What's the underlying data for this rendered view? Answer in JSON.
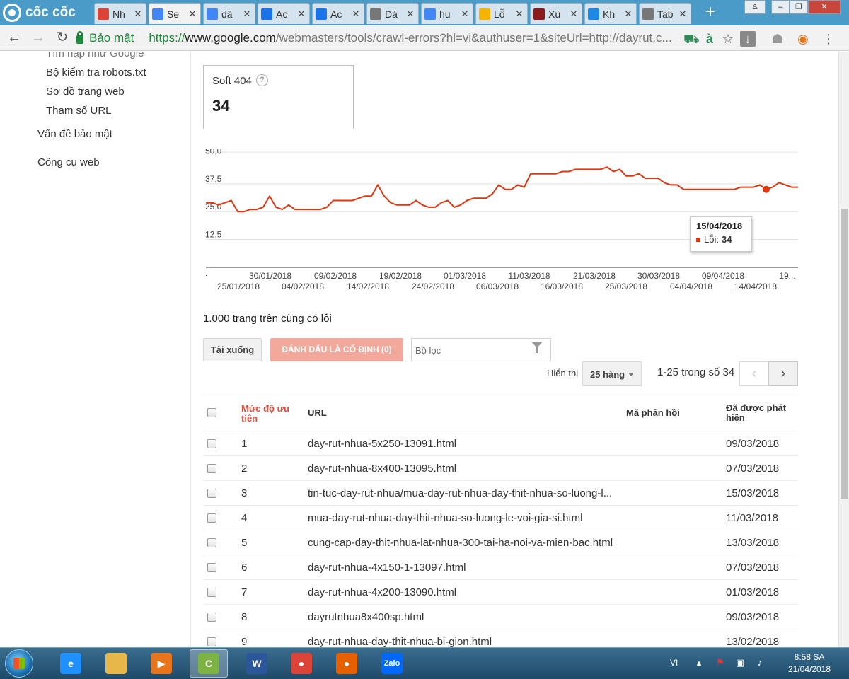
{
  "browser": {
    "brand": "cốc cốc",
    "tabs": [
      {
        "title": "Nh",
        "icon": "gmail-icon",
        "color": "#db4437"
      },
      {
        "title": "Se",
        "icon": "search-console-icon",
        "color": "#4285f4",
        "active": true
      },
      {
        "title": "dã",
        "icon": "google-icon",
        "color": "#4285f4"
      },
      {
        "title": "Ac",
        "icon": "adwords-icon",
        "color": "#1a73e8"
      },
      {
        "title": "Ac",
        "icon": "adwords-icon",
        "color": "#1a73e8"
      },
      {
        "title": "Dá",
        "icon": "page-icon",
        "color": "#777777"
      },
      {
        "title": "hu",
        "icon": "google-icon",
        "color": "#4285f4"
      },
      {
        "title": "Lỗ",
        "icon": "bug-icon",
        "color": "#f4b400"
      },
      {
        "title": "Xù",
        "icon": "k-icon",
        "color": "#8b1a1a"
      },
      {
        "title": "Kh",
        "icon": "t-icon",
        "color": "#1e88e5"
      },
      {
        "title": "Tab",
        "icon": "mute-icon",
        "color": "#777777"
      }
    ],
    "new_tab": "+",
    "secure_label": "Bảo mật",
    "url_scheme": "https://",
    "url_host": "www.google.com",
    "url_rest": "/webmasters/tools/crawl-errors?hl=vi&authuser=1&siteUrl=http://dayrut.c..."
  },
  "sidebar": {
    "items": [
      {
        "label": "Tìm nạp như Google"
      },
      {
        "label": "Bộ kiểm tra robots.txt"
      },
      {
        "label": "Sơ đồ trang web"
      },
      {
        "label": "Tham số URL"
      }
    ],
    "sections": [
      {
        "label": "Vấn đề bảo mật"
      },
      {
        "label": "Công cụ web"
      }
    ]
  },
  "summary_card": {
    "label": "Soft 404",
    "help": "?",
    "value": "34"
  },
  "chart_data": {
    "type": "line",
    "series": [
      {
        "name": "Lỗi",
        "color": "#dc3912",
        "values": [
          29,
          29,
          28,
          29,
          30,
          25,
          25,
          26,
          26,
          27,
          32,
          27,
          26,
          28,
          26,
          26,
          26,
          26,
          26,
          27,
          30,
          30,
          30,
          30,
          31,
          32,
          32,
          37,
          32,
          29,
          28,
          28,
          28,
          30,
          28,
          27,
          27,
          29,
          30,
          27,
          28,
          30,
          31,
          31,
          31,
          33,
          37,
          35,
          35,
          37,
          36,
          42,
          42,
          42,
          42,
          42,
          43,
          43,
          44,
          44,
          44,
          44,
          44,
          45,
          43,
          44,
          41,
          41,
          42,
          40,
          40,
          40,
          38,
          37,
          37,
          35,
          35,
          35,
          35,
          35,
          35,
          35,
          35,
          35,
          36,
          36,
          36,
          37,
          35,
          36,
          38,
          37,
          36,
          36
        ]
      }
    ],
    "x_labels_top": [
      "30/01/2018",
      "09/02/2018",
      "19/02/2018",
      "01/03/2018",
      "11/03/2018",
      "21/03/2018",
      "30/03/2018",
      "09/04/2018",
      "19..."
    ],
    "x_labels_bottom": [
      "25/01/2018",
      "04/02/2018",
      "14/02/2018",
      "24/02/2018",
      "06/03/2018",
      "16/03/2018",
      "25/03/2018",
      "04/04/2018",
      "14/04/2018"
    ],
    "y_ticks": [
      "50,0",
      "37,5",
      "25,0",
      "12,5"
    ],
    "ylim": [
      0,
      53
    ],
    "grid": true,
    "left_marker": "..",
    "highlight_index": 88,
    "tooltip": {
      "date": "15/04/2018",
      "label": "Lỗi:",
      "value": "34"
    }
  },
  "errors_summary": "1.000 trang trên cùng có lỗi",
  "actions": {
    "download": "Tải xuống",
    "mark_fixed": "ĐÁNH DẤU LÀ CỐ ĐỊNH (0)",
    "filter_placeholder": "Bộ lọc"
  },
  "pagination": {
    "rows_label": "Hiển thị",
    "rows_value": "25 hàng",
    "range": "1-25 trong số 34",
    "prev": "‹",
    "next": "›"
  },
  "table": {
    "headers": {
      "priority": "Mức độ ưu tiên",
      "url": "URL",
      "code": "Mã phản hồi",
      "detected": "Đã được phát hiện"
    },
    "rows": [
      {
        "priority": "1",
        "url": "day-rut-nhua-5x250-13091.html",
        "detected": "09/03/2018"
      },
      {
        "priority": "2",
        "url": "day-rut-nhua-8x400-13095.html",
        "detected": "07/03/2018"
      },
      {
        "priority": "3",
        "url": "tin-tuc-day-rut-nhua/mua-day-rut-nhua-day-thit-nhua-so-luong-l...",
        "detected": "15/03/2018"
      },
      {
        "priority": "4",
        "url": "mua-day-rut-nhua-day-thit-nhua-so-luong-le-voi-gia-si.html",
        "detected": "11/03/2018"
      },
      {
        "priority": "5",
        "url": "cung-cap-day-thit-nhua-lat-nhua-300-tai-ha-noi-va-mien-bac.html",
        "detected": "13/03/2018"
      },
      {
        "priority": "6",
        "url": "day-rut-nhua-4x150-1-13097.html",
        "detected": "07/03/2018"
      },
      {
        "priority": "7",
        "url": "day-rut-nhua-4x200-13090.html",
        "detected": "01/03/2018"
      },
      {
        "priority": "8",
        "url": "dayrutnhua8x400sp.html",
        "detected": "09/03/2018"
      },
      {
        "priority": "9",
        "url": "day-rut-nhua-day-thit-nhua-bi-gion.html",
        "detected": "13/02/2018"
      }
    ]
  },
  "taskbar": {
    "apps": [
      {
        "icon": "ie-icon",
        "color": "#1e90ff",
        "glyph": "e"
      },
      {
        "icon": "explorer-icon",
        "color": "#e8b74a",
        "glyph": ""
      },
      {
        "icon": "media-player-icon",
        "color": "#e8741c",
        "glyph": "▶"
      },
      {
        "icon": "coccoc-icon",
        "color": "#7cb342",
        "glyph": "C",
        "active": true
      },
      {
        "icon": "word-icon",
        "color": "#2b579a",
        "glyph": "W"
      },
      {
        "icon": "chrome-icon",
        "color": "#db4437",
        "glyph": "●"
      },
      {
        "icon": "firefox-icon",
        "color": "#e66000",
        "glyph": "●"
      },
      {
        "icon": "zalo-icon",
        "color": "#0068ff",
        "glyph": "Zalo"
      }
    ],
    "lang": "VI",
    "time": "8:58 SA",
    "date": "21/04/2018"
  }
}
